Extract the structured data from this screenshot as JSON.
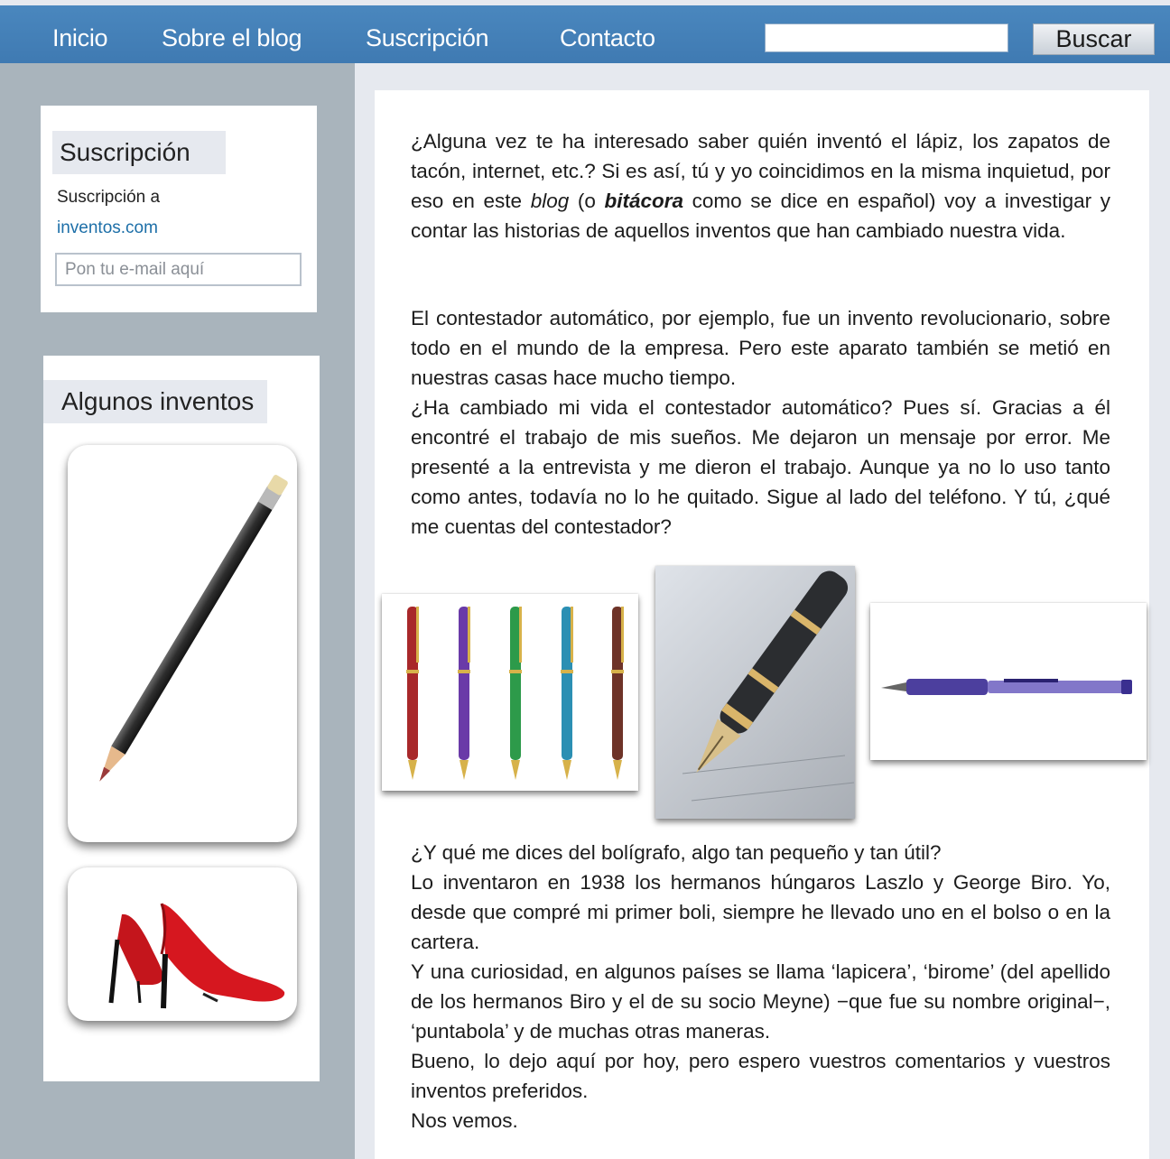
{
  "nav": {
    "items": [
      "Inicio",
      "Sobre el blog",
      "Suscripción",
      "Contacto"
    ],
    "search_value": "",
    "search_button": "Buscar"
  },
  "sidebar": {
    "subscription": {
      "title": "Suscripción",
      "text": "Suscripción a",
      "link": "inventos.com",
      "email_placeholder": "Pon tu e-mail aquí"
    },
    "inventions": {
      "title": "Algunos inventos"
    }
  },
  "post": {
    "p1_a": "¿Alguna vez te ha interesado saber quién inventó el lápiz, los zapatos de tacón, internet, etc.? Si es así, tú y yo coincidimos en la misma inquietud, por eso en este ",
    "p1_blog": "blog",
    "p1_b": " (o ",
    "p1_bitacora": "bitácora",
    "p1_c": " como se dice en español) voy a investigar y contar las historias de aquellos inventos que han cambiado nuestra vida.",
    "p2_a": "El contestador automático, por ejemplo, fue un invento revolucionario, sobre todo en el mundo de la empresa. Pero este aparato también se metió en nuestras casas hace mucho tiempo.",
    "p2_b": "¿Ha cambiado mi vida el contestador automático? Pues sí. Gracias a él encontré el trabajo de mis sueños. Me dejaron un mensaje por error. Me presenté a la entrevista y me dieron el trabajo. Aunque ya no lo uso tanto como antes, todavía no lo he quitado. Sigue al lado del teléfono. Y tú, ¿qué me cuentas del contestador?",
    "p3_a": "¿Y qué me dices del bolígrafo, algo tan pequeño y tan útil?",
    "p3_b": "Lo inventaron en 1938 los hermanos húngaros Laszlo y George Biro. Yo, desde que compré mi primer boli, siempre he llevado uno en el bolso o en la cartera.",
    "p3_c": "Y una curiosidad, en algunos países se llama ‘lapicera’, ‘birome’ (del apellido de los hermanos Biro y el de su socio Meyne) −que fue su nombre original−, ‘puntabola’ y de muchas otras maneras.",
    "p3_d": "Bueno, lo dejo aquí por hoy, pero espero vuestros comentarios y vuestros inventos preferidos.",
    "p3_e": "Nos vemos."
  },
  "colors": {
    "nav_bar": "#4a87be",
    "page_bg": "#e6e9ef",
    "sidebar_bg": "#a9b4bc",
    "link": "#1d6fa8"
  },
  "icons": {
    "pencil": "pencil-image",
    "shoes": "red-high-heels-image",
    "pens": "colored-pens-image",
    "fountain_pen": "fountain-pen-image",
    "ballpoint": "ballpoint-pen-image"
  }
}
